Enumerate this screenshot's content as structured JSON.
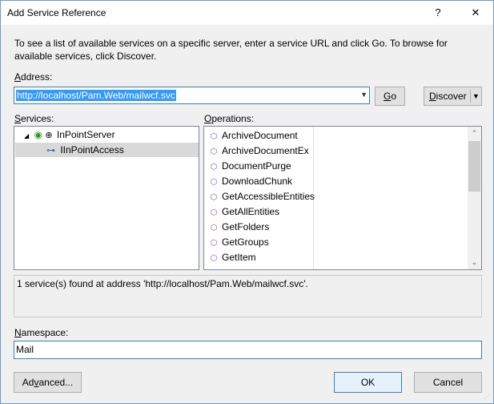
{
  "window": {
    "title": "Add Service Reference",
    "help_glyph": "?",
    "close_glyph": "✕"
  },
  "description": "To see a list of available services on a specific server, enter a service URL and click Go. To browse for available services, click Discover.",
  "address": {
    "label_accel": "A",
    "label_rest": "ddress:",
    "value": "http://localhost/Pam.Web/mailwcf.svc"
  },
  "buttons": {
    "go_accel": "G",
    "go_rest": "o",
    "discover_accel": "D",
    "discover_rest": "iscover",
    "advanced_pre": "Ad",
    "advanced_accel": "v",
    "advanced_post": "anced...",
    "ok": "OK",
    "cancel": "Cancel"
  },
  "services": {
    "label_accel": "S",
    "label_rest": "ervices:",
    "root": "InPointServer",
    "child": "IInPointAccess"
  },
  "operations": {
    "label_accel": "O",
    "label_rest": "perations:",
    "items": [
      "ArchiveDocument",
      "ArchiveDocumentEx",
      "DocumentPurge",
      "DownloadChunk",
      "GetAccessibleEntities",
      "GetAllEntities",
      "GetFolders",
      "GetGroups",
      "GetItem"
    ]
  },
  "status_text": "1 service(s) found at address 'http://localhost/Pam.Web/mailwcf.svc'.",
  "namespace": {
    "label_accel": "N",
    "label_rest": "amespace:",
    "value": "Mail"
  }
}
